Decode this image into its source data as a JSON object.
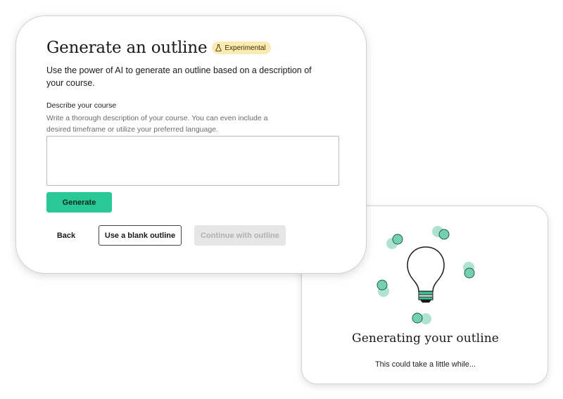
{
  "generate_card": {
    "title": "Generate an outline",
    "badge": {
      "label": "Experimental",
      "icon": "flask-icon",
      "color": "#fbeab1"
    },
    "description": "Use the power of AI to generate an outline based on a description of your course.",
    "field": {
      "label": "Describe your course",
      "hint": "Write a thorough description of your course. You can even include a desired timeframe or utilize your preferred language.",
      "value": "",
      "placeholder": ""
    },
    "generate_button": "Generate",
    "back_button": "Back",
    "blank_outline_button": "Use a blank outline",
    "continue_button": "Continue with outline",
    "continue_disabled": true
  },
  "loading_card": {
    "icon": "lightbulb-icon",
    "title": "Generating your outline",
    "subtitle": "This could take a little while..."
  },
  "colors": {
    "accent": "#2ac894",
    "dot_fill": "#40c69a",
    "dot_shadow": "#aee3cf",
    "badge_bg": "#fbeab1",
    "disabled_bg": "#e6e6e6"
  }
}
